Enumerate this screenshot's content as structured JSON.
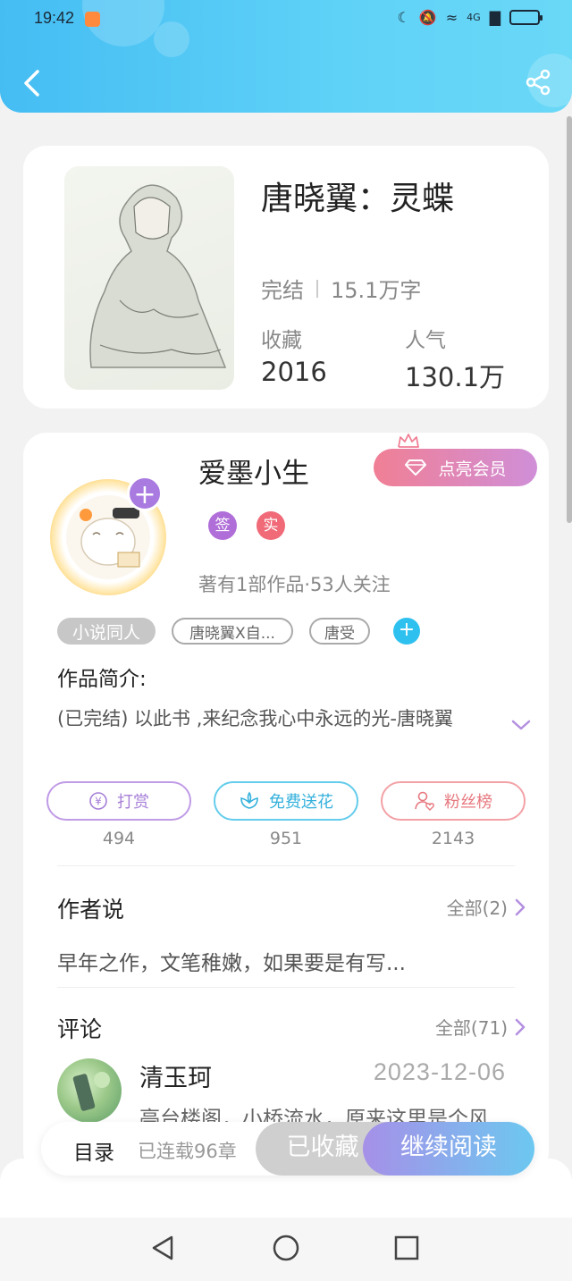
{
  "status_bar": {
    "time": "19:42",
    "network": "4G"
  },
  "colors": {
    "header": "#45bdf3",
    "accent_purple": "#a97ae0",
    "accent_blue": "#35b1dc",
    "accent_red": "#e7787f"
  },
  "header": {
    "back_icon": "chevron-left-icon",
    "share_icon": "share-icon"
  },
  "book": {
    "title": "唐晓翼：灵蝶",
    "status": "完结",
    "words": "15.1万字",
    "favorites_label": "收藏",
    "favorites_value": "2016",
    "popularity_label": "人气",
    "popularity_value": "130.1万"
  },
  "author": {
    "name": "爱墨小生",
    "vip_button": "点亮会员",
    "badge_sign": "签",
    "badge_real": "实",
    "stats": "著有1部作品·53人关注",
    "follow_plus": "+",
    "tags": [
      "小说同人",
      "唐晓翼X自...",
      "唐受"
    ],
    "tag_add": "+"
  },
  "intro": {
    "label": "作品简介:",
    "text": "(已完结) 以此书 ,来纪念我心中永远的光-唐晓翼"
  },
  "actions": [
    {
      "label": "打赏",
      "icon": "yen-icon",
      "count": "494"
    },
    {
      "label": "免费送花",
      "icon": "flower-icon",
      "count": "951"
    },
    {
      "label": "粉丝榜",
      "icon": "person-heart-icon",
      "count": "2143"
    }
  ],
  "author_says": {
    "title": "作者说",
    "all_link": "全部(2)",
    "text": "早年之作，文笔稚嫩，如果要是有写..."
  },
  "comments": {
    "title": "评论",
    "all_link": "全部(71)",
    "items": [
      {
        "user": "清玉珂",
        "date": "2023-12-06",
        "text": "亭台楼阁，小桥流水，原来这里是个风"
      }
    ]
  },
  "bottom_bar": {
    "toc": "目录",
    "serial": "已连载96章",
    "collected": "已收藏",
    "continue": "继续阅读"
  }
}
